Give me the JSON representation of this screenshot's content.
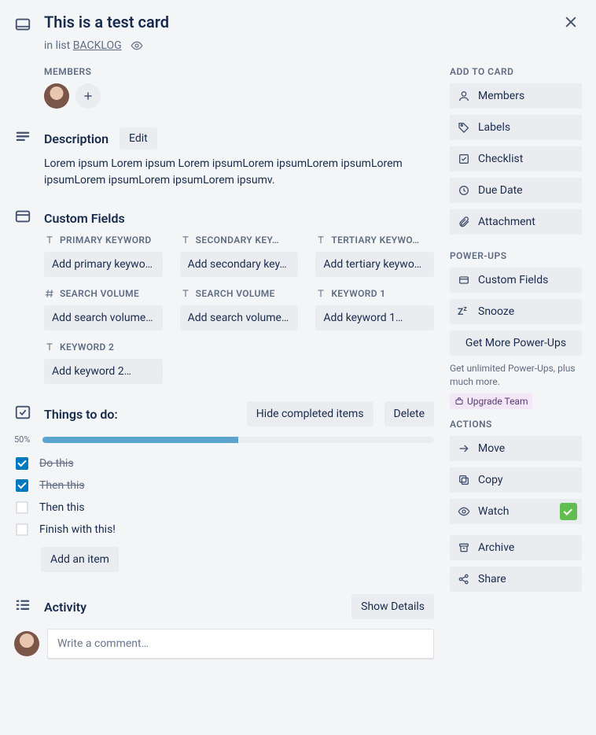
{
  "header": {
    "title": "This is a test card",
    "in_list_prefix": "in list ",
    "list_name": "BACKLOG"
  },
  "members": {
    "heading": "MEMBERS"
  },
  "description": {
    "heading": "Description",
    "edit_label": "Edit",
    "body": "Lorem ipsum Lorem ipsum Lorem ipsumLorem ipsumLorem ipsumLorem ipsumLorem ipsumLorem ipsumLorem ipsumv."
  },
  "custom_fields": {
    "heading": "Custom Fields",
    "items": [
      {
        "type": "text",
        "label": "PRIMARY KEYWORD",
        "placeholder": "Add primary keywo…"
      },
      {
        "type": "text",
        "label": "SECONDARY KEY…",
        "placeholder": "Add secondary key…"
      },
      {
        "type": "text",
        "label": "TERTIARY KEYWO…",
        "placeholder": "Add tertiary keywo…"
      },
      {
        "type": "number",
        "label": "SEARCH VOLUME",
        "placeholder": "Add search volume…"
      },
      {
        "type": "text",
        "label": "SEARCH VOLUME",
        "placeholder": "Add search volume…"
      },
      {
        "type": "text",
        "label": "KEYWORD 1",
        "placeholder": "Add keyword 1…"
      },
      {
        "type": "text",
        "label": "KEYWORD 2",
        "placeholder": "Add keyword 2…"
      }
    ]
  },
  "checklist": {
    "heading": "Things to do:",
    "hide_label": "Hide completed items",
    "delete_label": "Delete",
    "progress_pct": "50%",
    "progress_value": 50,
    "items": [
      {
        "done": true,
        "text": "Do this"
      },
      {
        "done": true,
        "text": "Then this"
      },
      {
        "done": false,
        "text": "Then this"
      },
      {
        "done": false,
        "text": "Finish with this!"
      }
    ],
    "add_item_label": "Add an item"
  },
  "activity": {
    "heading": "Activity",
    "show_details_label": "Show Details",
    "comment_placeholder": "Write a comment…"
  },
  "sidebar": {
    "add_heading": "ADD TO CARD",
    "add": {
      "members": "Members",
      "labels": "Labels",
      "checklist": "Checklist",
      "due_date": "Due Date",
      "attachment": "Attachment"
    },
    "powerups_heading": "POWER-UPS",
    "powerups": {
      "custom_fields": "Custom Fields",
      "snooze": "Snooze",
      "get_more": "Get More Power-Ups"
    },
    "powerups_note": "Get unlimited Power-Ups, plus much more.",
    "upgrade_label": "Upgrade Team",
    "actions_heading": "ACTIONS",
    "actions": {
      "move": "Move",
      "copy": "Copy",
      "watch": "Watch",
      "archive": "Archive",
      "share": "Share"
    }
  }
}
